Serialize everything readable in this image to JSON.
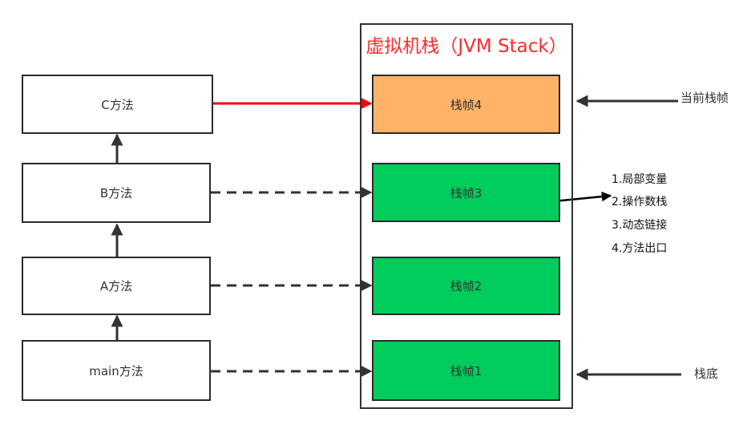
{
  "stack": {
    "title": "虚拟机栈（JVM Stack）"
  },
  "methods": [
    "C方法",
    "B方法",
    "A方法",
    "main方法"
  ],
  "frames": [
    "栈帧4",
    "栈帧3",
    "栈帧2",
    "栈帧1"
  ],
  "labels": {
    "current": "当前栈帧",
    "bottom": "栈底"
  },
  "frame_contents": [
    "1.局部变量",
    "2.操作数栈",
    "3.动态链接",
    "4.方法出口"
  ],
  "colors": {
    "current_frame": "#ffb366",
    "frame": "#00cc5c",
    "active_link": "#ff0000",
    "title": "#ff2a2a"
  }
}
